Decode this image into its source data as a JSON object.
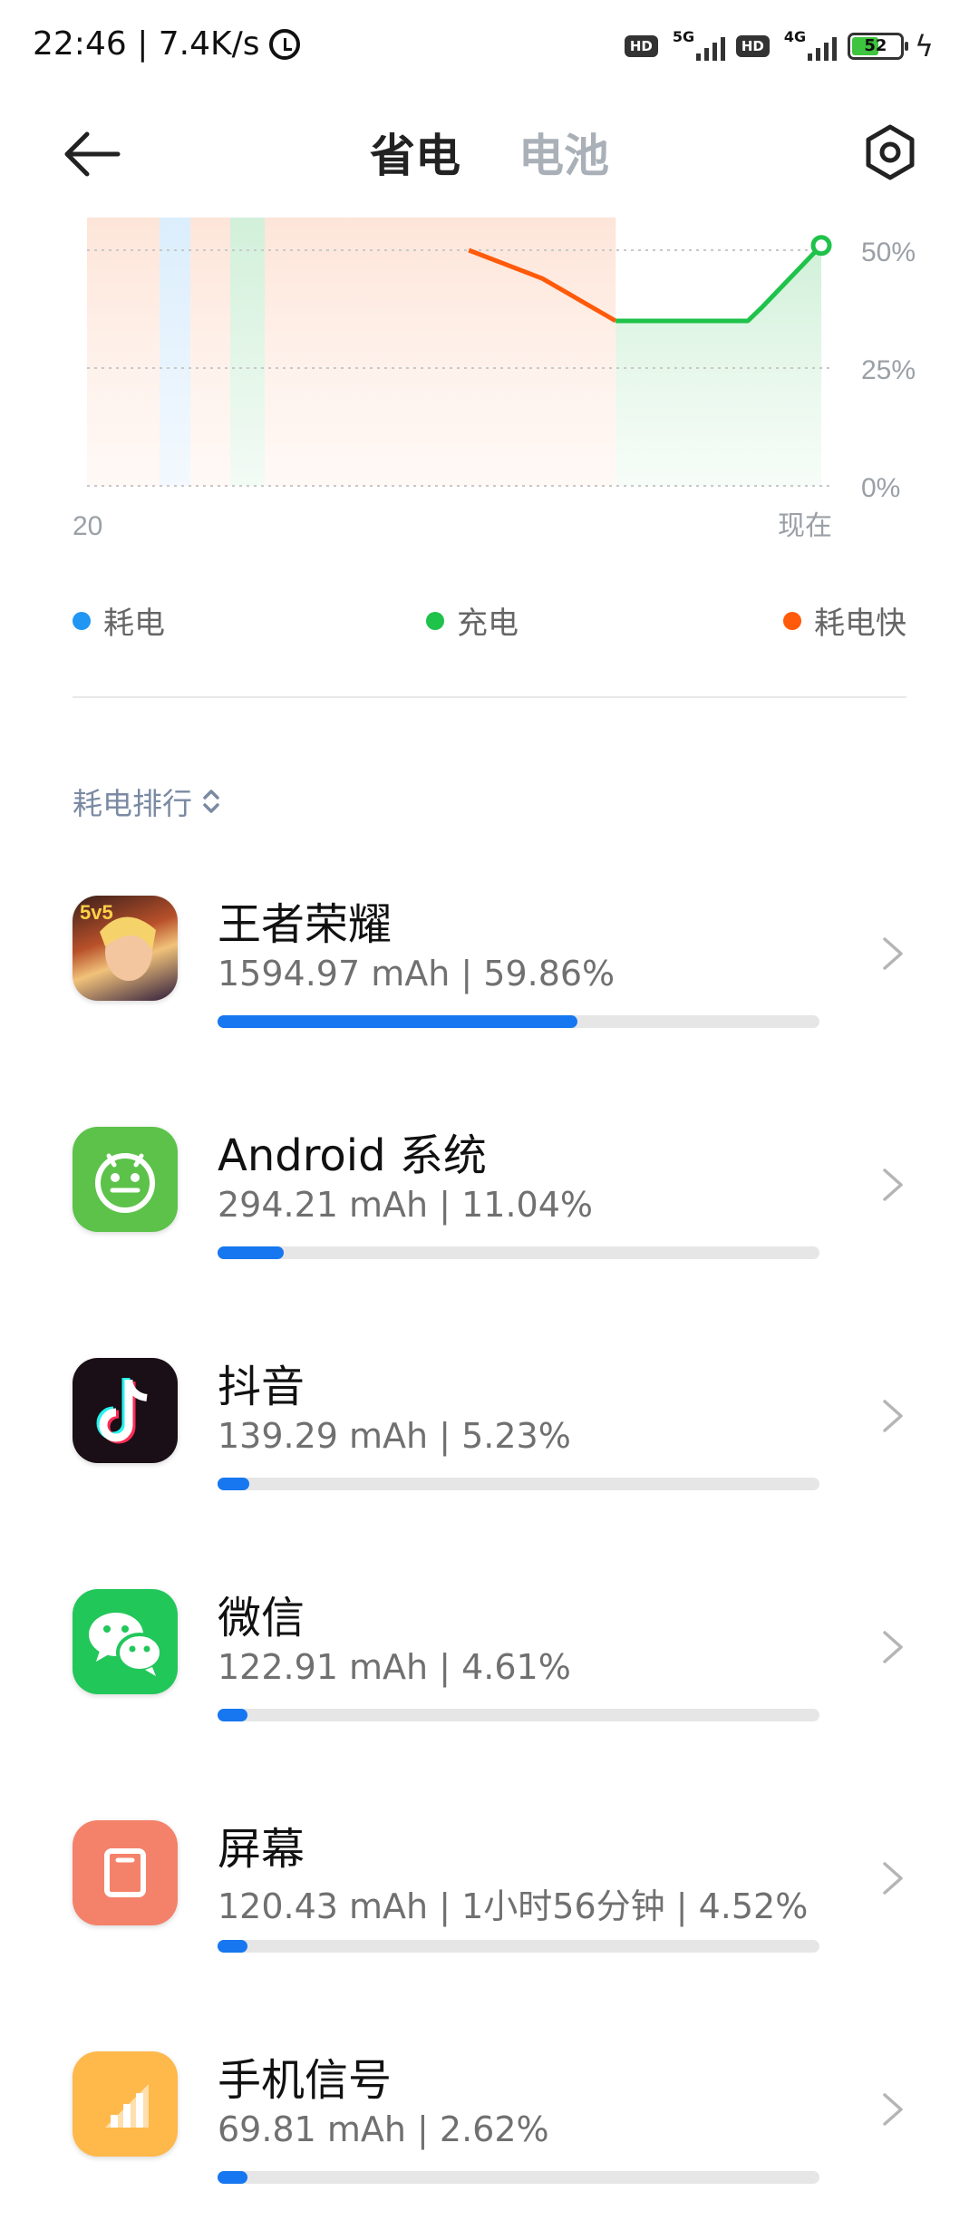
{
  "status_bar": {
    "time_speed": "22:46 | 7.4K/s",
    "hd1": "HD",
    "net1": "5G",
    "hd2": "HD",
    "net2": "4G",
    "battery": "52"
  },
  "header": {
    "tab_power_saving": "省电",
    "tab_battery": "电池"
  },
  "chart_data": {
    "type": "area",
    "y_ticks": [
      "50%",
      "25%",
      "0%"
    ],
    "x_ticks": [
      "20",
      "现在"
    ],
    "ylim": [
      0,
      50
    ],
    "discharge_fast_points": [
      [
        0.52,
        50
      ],
      [
        0.62,
        44
      ],
      [
        0.72,
        35
      ]
    ],
    "charge_points": [
      [
        0.72,
        35
      ],
      [
        0.9,
        35
      ],
      [
        0.92,
        38
      ],
      [
        1.0,
        51
      ]
    ],
    "colors": {
      "discharge": "#2196f3",
      "charge": "#1fc24a",
      "fast": "#ff5a0a"
    }
  },
  "legend": {
    "discharge": "耗电",
    "charge": "充电",
    "fast": "耗电快"
  },
  "rank": {
    "label": "耗电排行"
  },
  "apps": [
    {
      "name": "王者荣耀",
      "usage": "1594.97 mAh | 59.86%",
      "percent": 59.86,
      "icon": "game-icon"
    },
    {
      "name": "Android 系统",
      "usage": "294.21 mAh | 11.04%",
      "percent": 11.04,
      "icon": "android-icon"
    },
    {
      "name": "抖音",
      "usage": "139.29 mAh | 5.23%",
      "percent": 5.23,
      "icon": "tiktok-icon"
    },
    {
      "name": "微信",
      "usage": "122.91 mAh | 4.61%",
      "percent": 4.61,
      "icon": "wechat-icon"
    },
    {
      "name": "屏幕",
      "usage": "120.43 mAh | 1小时56分钟 | 4.52%",
      "percent": 4.52,
      "icon": "screen-icon"
    },
    {
      "name": "手机信号",
      "usage": "69.81 mAh | 2.62%",
      "percent": 2.62,
      "icon": "signal-icon"
    }
  ]
}
